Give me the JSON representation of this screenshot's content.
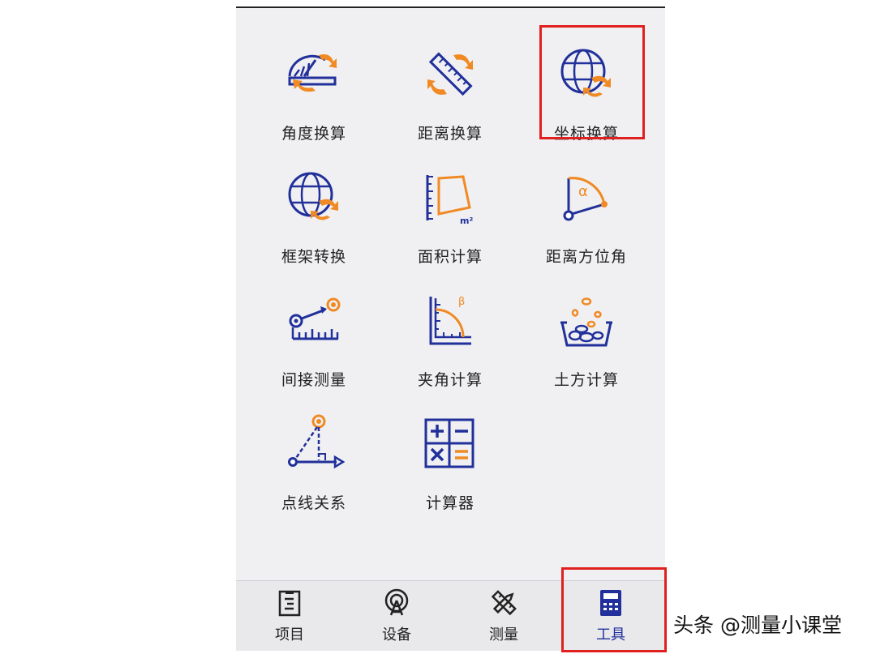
{
  "tools": [
    {
      "label": "角度换算",
      "icon": "angle-convert-icon"
    },
    {
      "label": "距离换算",
      "icon": "distance-convert-icon"
    },
    {
      "label": "坐标换算",
      "icon": "coordinate-convert-icon"
    },
    {
      "label": "框架转换",
      "icon": "frame-transform-icon"
    },
    {
      "label": "面积计算",
      "icon": "area-calc-icon"
    },
    {
      "label": "距离方位角",
      "icon": "distance-azimuth-icon"
    },
    {
      "label": "间接测量",
      "icon": "indirect-measure-icon"
    },
    {
      "label": "夹角计算",
      "icon": "included-angle-icon"
    },
    {
      "label": "土方计算",
      "icon": "earthwork-calc-icon"
    },
    {
      "label": "点线关系",
      "icon": "point-line-icon"
    },
    {
      "label": "计算器",
      "icon": "calculator-icon"
    }
  ],
  "icon_text": {
    "area_unit": "m²",
    "alpha": "α",
    "beta": "β"
  },
  "tabs": [
    {
      "label": "项目",
      "icon": "project-icon",
      "active": false
    },
    {
      "label": "设备",
      "icon": "device-icon",
      "active": false
    },
    {
      "label": "测量",
      "icon": "measure-icon",
      "active": false
    },
    {
      "label": "工具",
      "icon": "tools-icon",
      "active": true
    }
  ],
  "watermark": "头条 @测量小课堂",
  "colors": {
    "navy": "#21309a",
    "orange": "#f08a24",
    "highlight": "#e0201e",
    "background": "#f0f0f2"
  }
}
